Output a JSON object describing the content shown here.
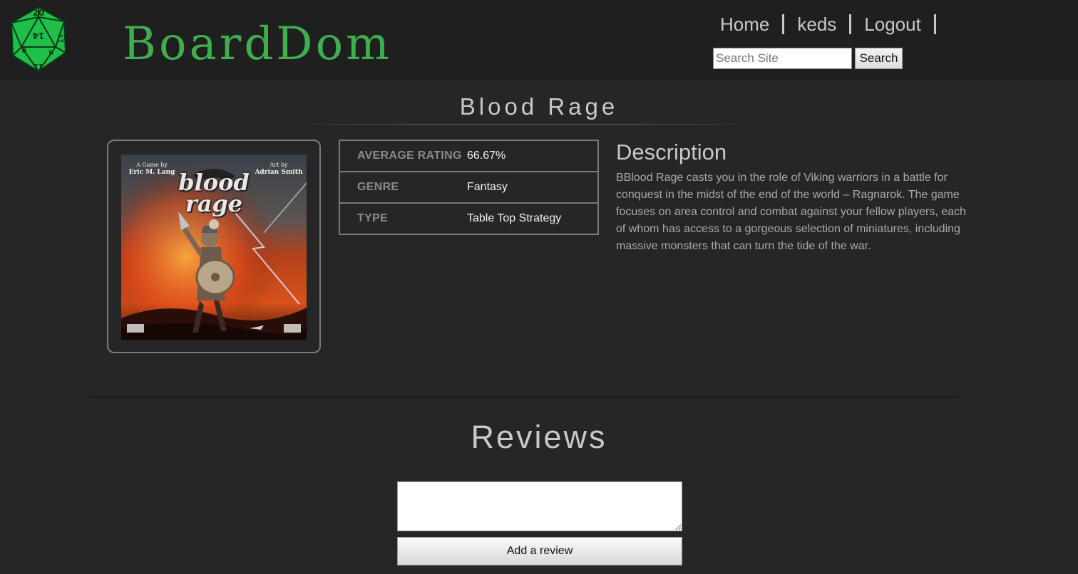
{
  "header": {
    "brand": "BoardDom",
    "logo_icon": "d20-die-icon",
    "logo_color": "#1fbf4a",
    "die_faces": [
      "20",
      "14",
      "6",
      "4",
      "17",
      "11"
    ],
    "nav": [
      {
        "label": "Home"
      },
      {
        "label": "keds"
      },
      {
        "label": "Logout"
      }
    ],
    "search": {
      "placeholder": "Search Site",
      "value": "",
      "button": "Search"
    }
  },
  "game": {
    "title": "Blood Rage",
    "cover": {
      "title_line1": "blood",
      "title_line2": "rage",
      "credit_left_top": "A Game by",
      "credit_left_bottom": "Eric M. Lang",
      "credit_right_top": "Art by",
      "credit_right_bottom": "Adrian Smith"
    },
    "stats": [
      {
        "key": "Average Rating",
        "value": "66.67%"
      },
      {
        "key": "Genre",
        "value": "Fantasy"
      },
      {
        "key": "Type",
        "value": "Table Top Strategy"
      }
    ],
    "description_heading": "Description",
    "description": "BBlood Rage casts you in the role of Viking warriors in a battle for conquest in the midst of the end of the world – Ragnarok. The game focuses on area control and combat against your fellow players, each of whom has access to a gorgeous selection of miniatures, including massive monsters that can turn the tide of the war."
  },
  "reviews": {
    "heading": "Reviews",
    "textarea_value": "",
    "button": "Add a review"
  },
  "colors": {
    "page_bg": "#262626",
    "header_bg": "#1f1f1f",
    "brand_green": "#3fae4f"
  }
}
